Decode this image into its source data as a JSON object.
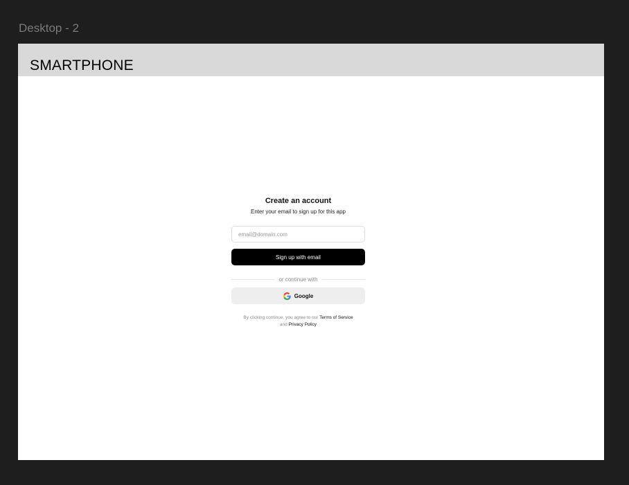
{
  "canvas": {
    "frame_label": "Desktop - 2"
  },
  "header": {
    "brand": "SMARTPHONE"
  },
  "signup": {
    "title": "Create an account",
    "subtitle": "Enter your email to sign up for this app",
    "email_placeholder": "email@domain.com",
    "email_value": "",
    "submit_label": "Sign up with email",
    "divider_label": "or continue with",
    "google_label": "Google",
    "google_icon": "google-icon",
    "legal_prefix": "By clicking continue, you agree to our",
    "terms_label": "Terms of Service",
    "legal_join": "and",
    "privacy_label": "Privacy Policy"
  },
  "colors": {
    "canvas_bg": "#1e1e1e",
    "header_bg": "#d9d9d9",
    "primary_button": "#000000",
    "secondary_button": "#eeeeee",
    "google_blue": "#4285F4",
    "google_red": "#EA4335",
    "google_yellow": "#FBBC05",
    "google_green": "#34A853"
  }
}
